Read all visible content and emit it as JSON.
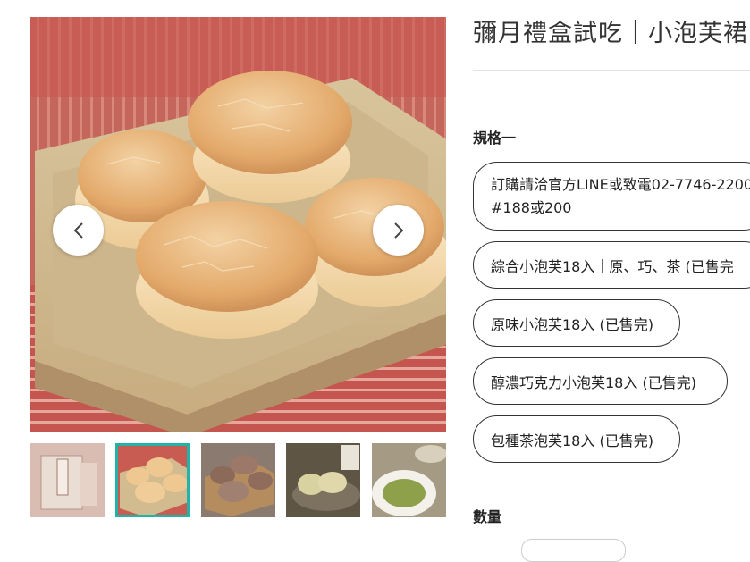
{
  "product": {
    "title": "彌月禮盒試吃｜小泡芙裙"
  },
  "gallery": {
    "thumbnails": [
      {
        "name": "thumb-giftbox"
      },
      {
        "name": "thumb-original-puffs",
        "active": true
      },
      {
        "name": "thumb-chocolate-puffs"
      },
      {
        "name": "thumb-tea-puffs"
      },
      {
        "name": "thumb-matcha-powder"
      }
    ],
    "prev_icon": "chevron-left-icon",
    "next_icon": "chevron-right-icon"
  },
  "spec": {
    "label": "規格一",
    "options": [
      {
        "line1": "訂購請洽官方LINE或致電02-7746-2200",
        "line2": "#188或200"
      },
      {
        "label": "綜合小泡芙18入｜原、巧、茶 (已售完"
      },
      {
        "label": "原味小泡芙18入 (已售完)"
      },
      {
        "label": "醇濃巧克力小泡芙18入 (已售完)"
      },
      {
        "label": "包種茶泡芙18入 (已售完)"
      }
    ]
  },
  "quantity": {
    "label": "數量"
  },
  "colors": {
    "accent": "#22b3a8",
    "border": "#333333"
  }
}
